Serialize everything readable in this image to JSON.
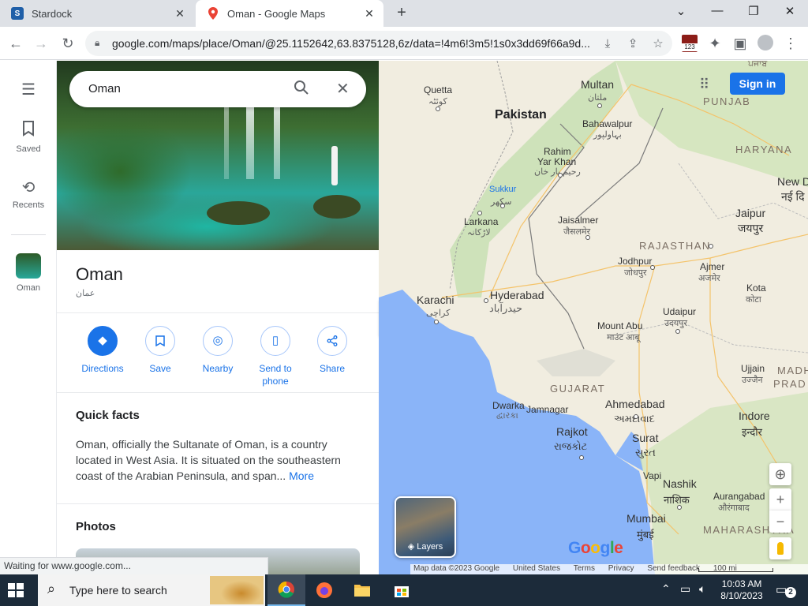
{
  "browser": {
    "tabs": [
      {
        "title": "Stardock",
        "icon": "stardock-icon"
      },
      {
        "title": "Oman - Google Maps",
        "icon": "google-maps-icon"
      }
    ],
    "url": "google.com/maps/place/Oman/@25.1152642,63.8375128,6z/data=!4m6!3m5!1s0x3dd69f66a9d...",
    "extension_badge": "123"
  },
  "rail": {
    "saved": "Saved",
    "recents": "Recents",
    "oman": "Oman"
  },
  "search": {
    "query": "Oman"
  },
  "place": {
    "title": "Oman",
    "subtitle": "عمان",
    "actions": {
      "directions": "Directions",
      "save": "Save",
      "nearby": "Nearby",
      "send_to_phone": "Send to phone",
      "share": "Share"
    },
    "quick_facts_title": "Quick facts",
    "quick_facts_text": "Oman, officially the Sultanate of Oman, is a country located in West Asia. It is situated on the southeastern coast of the Arabian Peninsula, and span...",
    "more": "More",
    "photos_title": "Photos"
  },
  "map": {
    "sign_in": "Sign in",
    "layers": "Layers",
    "google": "Google",
    "footer": {
      "map_data": "Map data ©2023 Google",
      "country": "United States",
      "terms": "Terms",
      "privacy": "Privacy",
      "feedback": "Send feedback",
      "scale": "100 mi"
    },
    "labels": {
      "pakistan": "Pakistan",
      "quetta": "Quetta",
      "quetta_ur": "کوئٹہ",
      "multan": "Multan",
      "multan_ur": "ملتان",
      "bahawalpur": "Bahawalpur",
      "bahawalpur_ur": "بہاولپور",
      "punjab": "PUNJAB",
      "punjab_gu": "ਪੰਜਾਬ",
      "haryana": "HARYANA",
      "rahim": "Rahim",
      "yarkhan": "Yar Khan",
      "rahim_ur": "رحیم یار خان",
      "sukkur": "Sukkur",
      "sukkur_ur": "سکھر",
      "larkana": "Larkana",
      "larkana_ur": "لاڑکانہ",
      "jaisalmer": "Jaisalmer",
      "jaisalmer_hi": "जैसलमेर",
      "jaipur": "Jaipur",
      "jaipur_hi": "जयपुर",
      "newdelhi": "New D",
      "newdelhi_hi": "नई दि",
      "rajasthan": "RAJASTHAN",
      "jodhpur": "Jodhpur",
      "jodhpur_hi": "जोधपुर",
      "ajmer": "Ajmer",
      "ajmer_hi": "अजमेर",
      "kota": "Kota",
      "kota_hi": "कोटा",
      "karachi": "Karachi",
      "karachi_ur": "کراچی",
      "hyderabad": "Hyderabad",
      "hyderabad_ur": "حیدرآباد",
      "udaipur": "Udaipur",
      "udaipur_hi": "उदयपुर",
      "mountabu": "Mount Abu",
      "mountabu_hi": "माउंट आबू",
      "ujjain": "Ujjain",
      "ujjain_hi": "उज्जैन",
      "madhya": "MADH",
      "pradesh": "PRAD",
      "gujarat": "GUJARAT",
      "ahmedabad": "Ahmedabad",
      "ahmedabad_gu": "અમદાવાદ",
      "indore": "Indore",
      "indore_hi": "इन्दौर",
      "dwarka": "Dwarka",
      "dwarka_gu": "દ્વારકા",
      "jamnagar": "Jamnagar",
      "rajkot": "Rajkot",
      "rajkot_gu": "રાજકોટ",
      "surat": "Surat",
      "surat_gu": "સુરત",
      "vapi": "Vapi",
      "nashik": "Nashik",
      "nashik_hi": "नाशिक",
      "aurangabad": "Aurangabad",
      "aurangabad_hi": "औरंगाबाद",
      "mumbai": "Mumbai",
      "mumbai_hi": "मुंबई",
      "maharashtra": "MAHARASHTRA"
    }
  },
  "status_bar": "Waiting for www.google.com...",
  "taskbar": {
    "search_placeholder": "Type here to search",
    "time": "10:03 AM",
    "date": "8/10/2023",
    "notifications": "2"
  }
}
